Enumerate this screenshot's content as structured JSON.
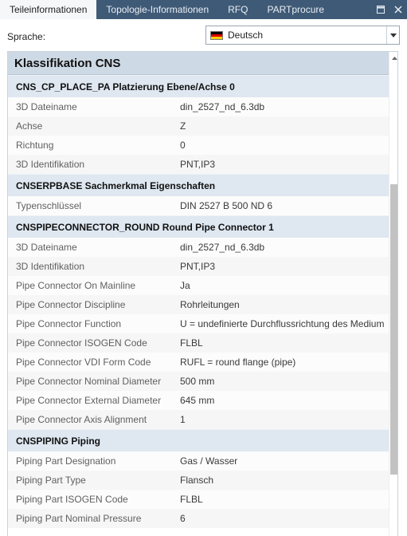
{
  "tabs": [
    {
      "label": "Teileinformationen",
      "active": true
    },
    {
      "label": "Topologie-Informationen",
      "active": false
    },
    {
      "label": "RFQ",
      "active": false
    },
    {
      "label": "PARTprocure",
      "active": false
    }
  ],
  "window_controls": {
    "restore_icon": "window-restore-icon",
    "close_icon": "close-icon"
  },
  "language": {
    "label": "Sprache:",
    "selected": "Deutsch",
    "flag_icon": "germany-flag-icon",
    "flag_colors": [
      "#000000",
      "#dd0000",
      "#ffce00"
    ]
  },
  "panel": {
    "title": "Klassifikation CNS",
    "groups": [
      {
        "name": "CNS_CP_PLACE_PA Platzierung Ebene/Achse 0",
        "rows": [
          {
            "key": "3D Dateiname",
            "value": "din_2527_nd_6.3db"
          },
          {
            "key": "Achse",
            "value": "Z"
          },
          {
            "key": "Richtung",
            "value": "0"
          },
          {
            "key": "3D Identifikation",
            "value": "PNT,IP3"
          }
        ]
      },
      {
        "name": "CNSERPBASE Sachmerkmal Eigenschaften",
        "rows": [
          {
            "key": "Typenschlüssel",
            "value": "DIN 2527 B 500 ND 6"
          }
        ]
      },
      {
        "name": "CNSPIPECONNECTOR_ROUND Round Pipe Connector 1",
        "rows": [
          {
            "key": "3D Dateiname",
            "value": "din_2527_nd_6.3db"
          },
          {
            "key": "3D Identifikation",
            "value": "PNT,IP3"
          },
          {
            "key": "Pipe Connector On Mainline",
            "value": "Ja"
          },
          {
            "key": "Pipe Connector Discipline",
            "value": "Rohrleitungen"
          },
          {
            "key": "Pipe Connector Function",
            "value": "U = undefinierte Durchflussrichtung des Medium"
          },
          {
            "key": "Pipe Connector ISOGEN Code",
            "value": "FLBL"
          },
          {
            "key": "Pipe Connector VDI Form Code",
            "value": "RUFL = round flange (pipe)"
          },
          {
            "key": "Pipe Connector Nominal Diameter",
            "value": "500 mm"
          },
          {
            "key": "Pipe Connector External Diameter",
            "value": "645 mm"
          },
          {
            "key": "Pipe Connector Axis Alignment",
            "value": "1"
          }
        ]
      },
      {
        "name": "CNSPIPING Piping",
        "rows": [
          {
            "key": "Piping Part Designation",
            "value": "Gas / Wasser"
          },
          {
            "key": "Piping Part Type",
            "value": "Flansch"
          },
          {
            "key": "Piping Part ISOGEN Code",
            "value": "FLBL"
          },
          {
            "key": "Piping Part Nominal Pressure",
            "value": "6"
          }
        ]
      }
    ]
  },
  "scrollbar": {
    "up_icon": "scroll-up-arrow-icon"
  }
}
